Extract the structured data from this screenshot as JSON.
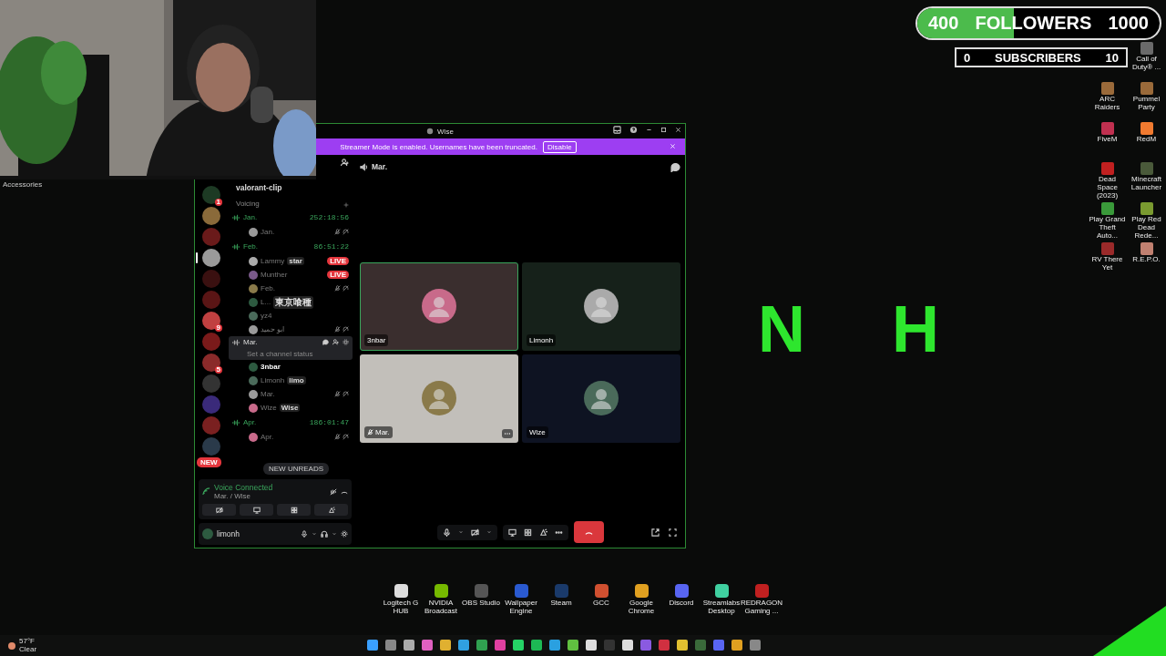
{
  "desktop_label": "Accessories",
  "goals": [
    {
      "kind": "pill",
      "start": "400",
      "label": "FOLLOWERS",
      "target": "1000",
      "level": 0.4
    },
    {
      "kind": "box",
      "start": "0",
      "label": "SUBSCRIBERS",
      "target": "10",
      "level": 0
    }
  ],
  "desktop_icons": [
    {
      "label": "Call of Duty® ...",
      "kind": "app"
    },
    {
      "label": "ARC Raiders",
      "kind": "app"
    },
    {
      "label": "Pummel Party",
      "kind": "app"
    },
    {
      "label": "FiveM",
      "kind": "app"
    },
    {
      "label": "RedM",
      "kind": "app"
    },
    {
      "label": "Dead Space (2023)",
      "kind": "app"
    },
    {
      "label": "Minecraft Launcher",
      "kind": "app"
    },
    {
      "label": "Play Grand Theft Auto...",
      "kind": "app"
    },
    {
      "label": "Play Red Dead Rede...",
      "kind": "app"
    },
    {
      "label": "RV There Yet",
      "kind": "app"
    },
    {
      "label": "R.E.P.O.",
      "kind": "app"
    }
  ],
  "wallpaper_letters": [
    "N",
    "H"
  ],
  "window": {
    "title": "Wise",
    "banner": {
      "text": "Streamer Mode is enabled. Usernames have been truncated.",
      "button": "Disable"
    },
    "servers": [
      {
        "badge": "1",
        "selected": false
      },
      {
        "selected": false
      },
      {
        "selected": false
      },
      {
        "selected": true
      },
      {
        "selected": false
      },
      {
        "selected": false
      },
      {
        "badge": "9",
        "selected": false
      },
      {
        "selected": false
      },
      {
        "badge": "5",
        "selected": false
      },
      {
        "selected": false
      },
      {
        "selected": false
      },
      {
        "selected": false
      },
      {
        "selected": false
      }
    ],
    "new_pill": "NEW",
    "text_channel": "valorant-clip",
    "section": "Voicing",
    "voice_channels": [
      {
        "name": "Jan.",
        "timer": "252:18:56",
        "selected": false,
        "users": [
          {
            "name": "Jan.",
            "muted": true,
            "speaking": false
          }
        ]
      },
      {
        "name": "Feb.",
        "timer": "86:51:22",
        "selected": false,
        "users": [
          {
            "name": "Lammy",
            "badge": "star",
            "status_badge": "LIVE",
            "muted": false,
            "speaking": false
          },
          {
            "name": "Munther",
            "status_badge": "LIVE",
            "muted": false,
            "speaking": false
          },
          {
            "name": "Feb.",
            "muted": true,
            "speaking": false
          },
          {
            "name": "L...",
            "badge": "東京喰種",
            "muted": false,
            "speaking": false
          },
          {
            "name": "yz4",
            "muted": false,
            "speaking": false
          },
          {
            "name": "ابو حميد",
            "muted": true,
            "speaking": false
          }
        ]
      },
      {
        "name": "Mar.",
        "status": "Set a channel status",
        "selected": true,
        "users": [
          {
            "name": "3nbar",
            "muted": false,
            "speaking": true
          },
          {
            "name": "Limonh",
            "badge": "limo",
            "muted": false,
            "speaking": false
          },
          {
            "name": "Mar.",
            "muted": true,
            "speaking": false
          },
          {
            "name": "Wize",
            "badge": "Wise",
            "muted": false,
            "speaking": false
          }
        ]
      },
      {
        "name": "Apr.",
        "timer": "186:01:47",
        "selected": false,
        "users": [
          {
            "name": "Apr.",
            "muted": true,
            "speaking": false
          }
        ]
      }
    ],
    "new_unreads": "NEW UNREADS",
    "voice_panel": {
      "title": "Voice Connected",
      "subtitle": "Mar. / Wise"
    },
    "user_panel": {
      "name": "limonh"
    },
    "call": {
      "channel": "Mar.",
      "tiles": [
        {
          "name": "3nbar",
          "speaking": true,
          "muted": false,
          "menu": false,
          "color": "#3a2e2e"
        },
        {
          "name": "Limonh",
          "speaking": false,
          "muted": false,
          "menu": false,
          "color": "#16211a"
        },
        {
          "name": "Mar.",
          "speaking": false,
          "muted": true,
          "menu": true,
          "color": "#c2bfba"
        },
        {
          "name": "Wize",
          "speaking": false,
          "muted": false,
          "menu": false,
          "color": "#0e1322"
        }
      ]
    }
  },
  "dock": [
    "Logitech G HUB",
    "NVIDIA Broadcast",
    "OBS Studio",
    "Wallpaper Engine",
    "Steam",
    "GCC",
    "Google Chrome",
    "Discord",
    "Streamlabs Desktop",
    "REDRAGON Gaming ..."
  ],
  "taskbar": {
    "weather": {
      "temp": "57°F",
      "condition": "Clear"
    }
  }
}
